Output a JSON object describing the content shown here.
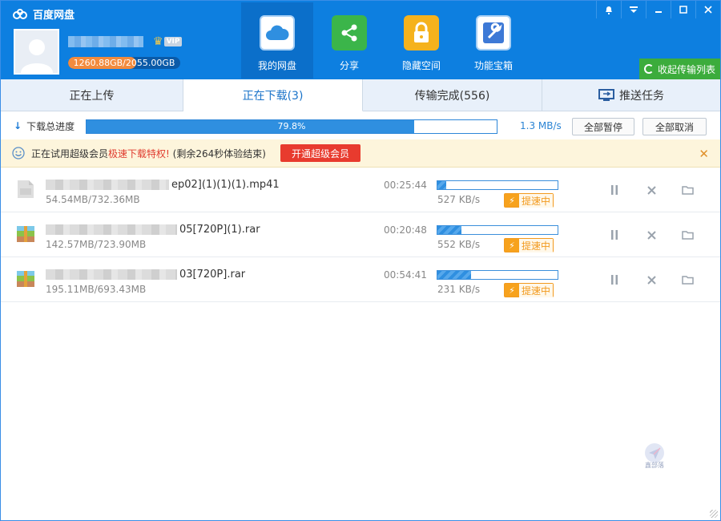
{
  "app": {
    "title": "百度网盘"
  },
  "user": {
    "quota": "1260.88GB/2055.00GB",
    "quota_fraction": 0.61,
    "vip_label": "VIP"
  },
  "nav": [
    {
      "label": "我的网盘",
      "icon": "cloud-icon",
      "active": true
    },
    {
      "label": "分享",
      "icon": "share-icon",
      "active": false
    },
    {
      "label": "隐藏空间",
      "icon": "lock-icon",
      "active": false
    },
    {
      "label": "功能宝箱",
      "icon": "toolbox-icon",
      "active": false
    }
  ],
  "window_controls": [
    "bell-icon",
    "menu-icon",
    "minimize-icon",
    "maximize-icon",
    "close-icon"
  ],
  "collapse_label": "收起传输列表",
  "tabs": [
    {
      "label": "正在上传"
    },
    {
      "label": "正在下载(3)"
    },
    {
      "label": "传输完成(556)"
    },
    {
      "label": "推送任务"
    }
  ],
  "total": {
    "label": "下载总进度",
    "percent": "79.8%",
    "fraction": 0.798,
    "speed": "1.3 MB/s",
    "pause_all": "全部暂停",
    "cancel_all": "全部取消"
  },
  "promo": {
    "text_a": "正在试用超级会员",
    "text_red": "极速下载特权!",
    "text_b": "(剩余264秒体验结束)",
    "button": "开通超级会员"
  },
  "downloads": [
    {
      "name_suffix": "ep02](1)(1)(1).mp41",
      "size": "54.54MB/732.36MB",
      "time": "00:25:44",
      "fraction": 0.07,
      "speed": "527 KB/s",
      "boost": "提速中",
      "icon": "file-icon"
    },
    {
      "name_suffix": "05[720P](1).rar",
      "size": "142.57MB/723.90MB",
      "time": "00:20:48",
      "fraction": 0.2,
      "speed": "552 KB/s",
      "boost": "提速中",
      "icon": "archive-icon"
    },
    {
      "name_suffix": "03[720P].rar",
      "size": "195.11MB/693.43MB",
      "time": "00:54:41",
      "fraction": 0.28,
      "speed": "231 KB/s",
      "boost": "提速中",
      "icon": "archive-icon"
    }
  ],
  "watermark": "鑫部落",
  "colors": {
    "header": "#0d7fe0",
    "accent": "#2f8fe0",
    "promo_button": "#e83b2e",
    "boost": "#f29a1f",
    "collapse_button": "#3cac3c"
  }
}
